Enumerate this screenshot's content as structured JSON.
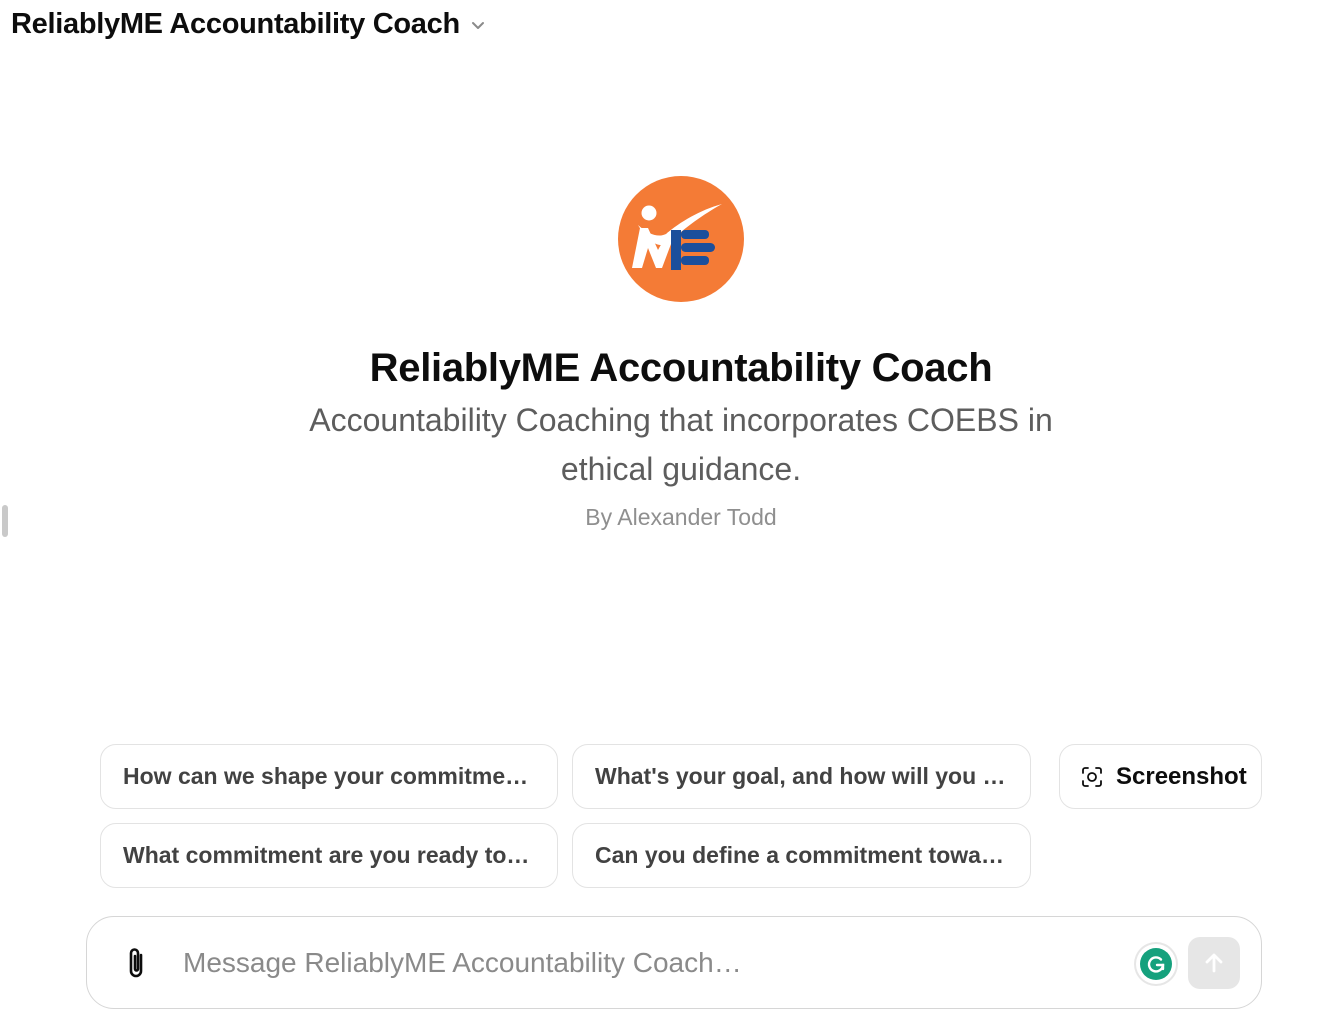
{
  "header": {
    "title": "ReliablyME Accountability Coach",
    "dropdown_icon": "chevron-down-icon"
  },
  "gpt": {
    "logo": "reliablyme-logo",
    "name": "ReliablyME Accountability Coach",
    "description": "Accountability Coaching that incorporates COEBS in ethical guidance.",
    "author": "By Alexander Todd",
    "brand_colors": {
      "logo_orange": "#f47b36",
      "logo_blue": "#1b4f9c"
    }
  },
  "suggestions": [
    {
      "label": "How can we shape your commitment to be more specific?"
    },
    {
      "label": "What's your goal, and how will you commit to it?"
    },
    {
      "label": "What commitment are you ready to make today?"
    },
    {
      "label": "Can you define a commitment toward your goal?"
    }
  ],
  "screenshot_button": {
    "label": "Screenshot",
    "icon": "screenshot-icon"
  },
  "composer": {
    "placeholder": "Message ReliablyME Accountability Coach…",
    "attach_icon": "paperclip-icon",
    "grammarly_icon": "grammarly-icon",
    "send_icon": "arrow-up-icon",
    "grammarly_color": "#15a17d"
  }
}
